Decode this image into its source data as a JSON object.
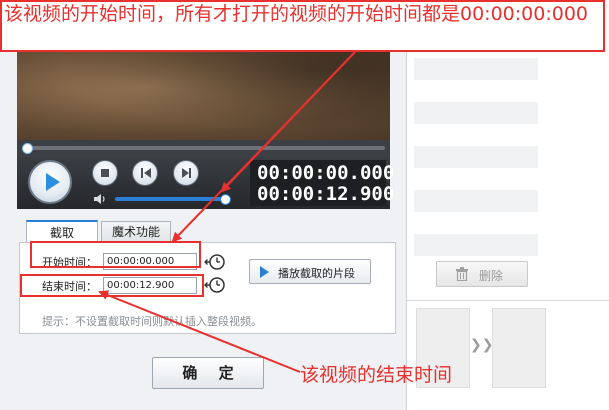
{
  "annotations": {
    "top_text": "该视频的开始时间，所有才打开的视频的开始时间都是00:00:00:000",
    "bottom_text": "该视频的结束时间",
    "color": "#e8312e"
  },
  "player": {
    "current_time": "00:00:00.000",
    "total_time": "00:00:12.900",
    "seek_progress": 0.0,
    "volume_level": 0.95
  },
  "tabs": [
    {
      "label": "截取",
      "active": true
    },
    {
      "label": "魔术功能",
      "active": false
    }
  ],
  "clip": {
    "start_label": "开始时间：",
    "start_value": "00:00:00.000",
    "end_label": "结束时间：",
    "end_value": "00:00:12.900",
    "play_segment_label": "播放截取的片段",
    "hint": "提示：不设置截取时间则默认插入整段视频。"
  },
  "dialog": {
    "ok_label": "确 定"
  },
  "right_panel": {
    "delete_label": "删除"
  },
  "colors": {
    "accent": "#2a7fd6",
    "annotation": "#e8312e"
  },
  "icons": [
    "play-icon",
    "stop-icon",
    "previous-icon",
    "next-icon",
    "volume-icon",
    "clock-icon",
    "trash-icon",
    "double-chevron-icon"
  ]
}
